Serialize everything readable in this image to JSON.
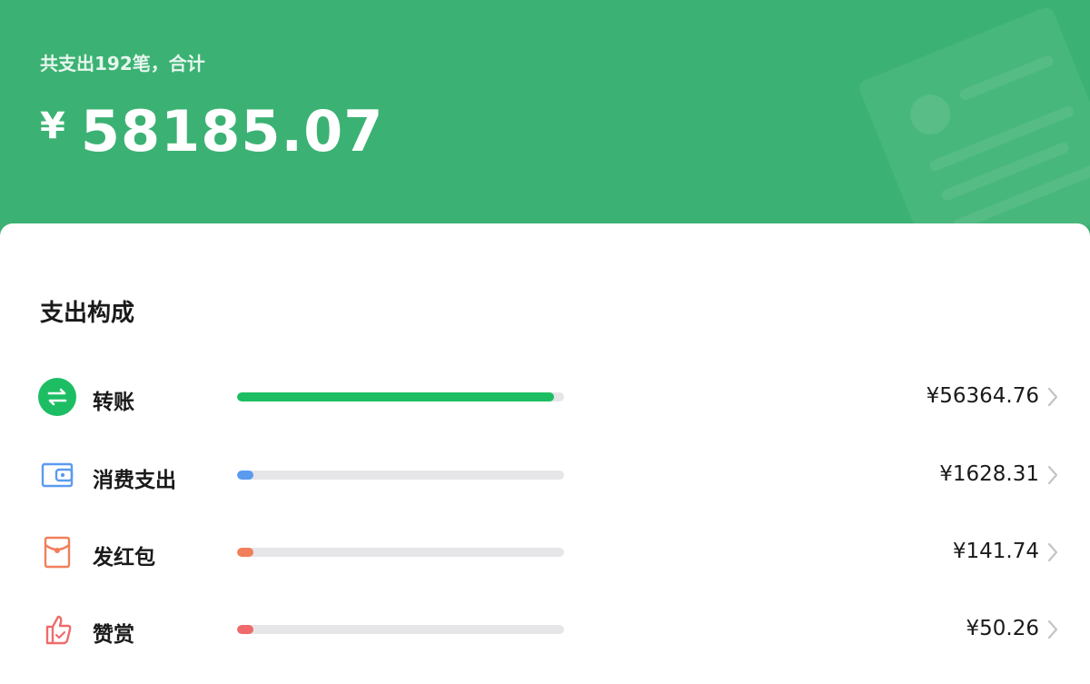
{
  "header": {
    "summary": "共支出192笔，合计",
    "currency": "¥",
    "total": "58185.07"
  },
  "section": {
    "title": "支出构成"
  },
  "items": [
    {
      "label": "转账",
      "amount": "¥56364.76",
      "fraction": 0.969,
      "color": "#1dbe63",
      "icon": "transfer-icon"
    },
    {
      "label": "消费支出",
      "amount": "¥1628.31",
      "fraction": 0.028,
      "color": "#5a9bf0",
      "icon": "wallet-icon"
    },
    {
      "label": "发红包",
      "amount": "¥141.74",
      "fraction": 0.0024,
      "color": "#f17f5a",
      "icon": "red-packet-icon"
    },
    {
      "label": "赞赏",
      "amount": "¥50.26",
      "fraction": 0.0009,
      "color": "#ef6b6b",
      "icon": "thumbs-up-icon"
    }
  ]
}
